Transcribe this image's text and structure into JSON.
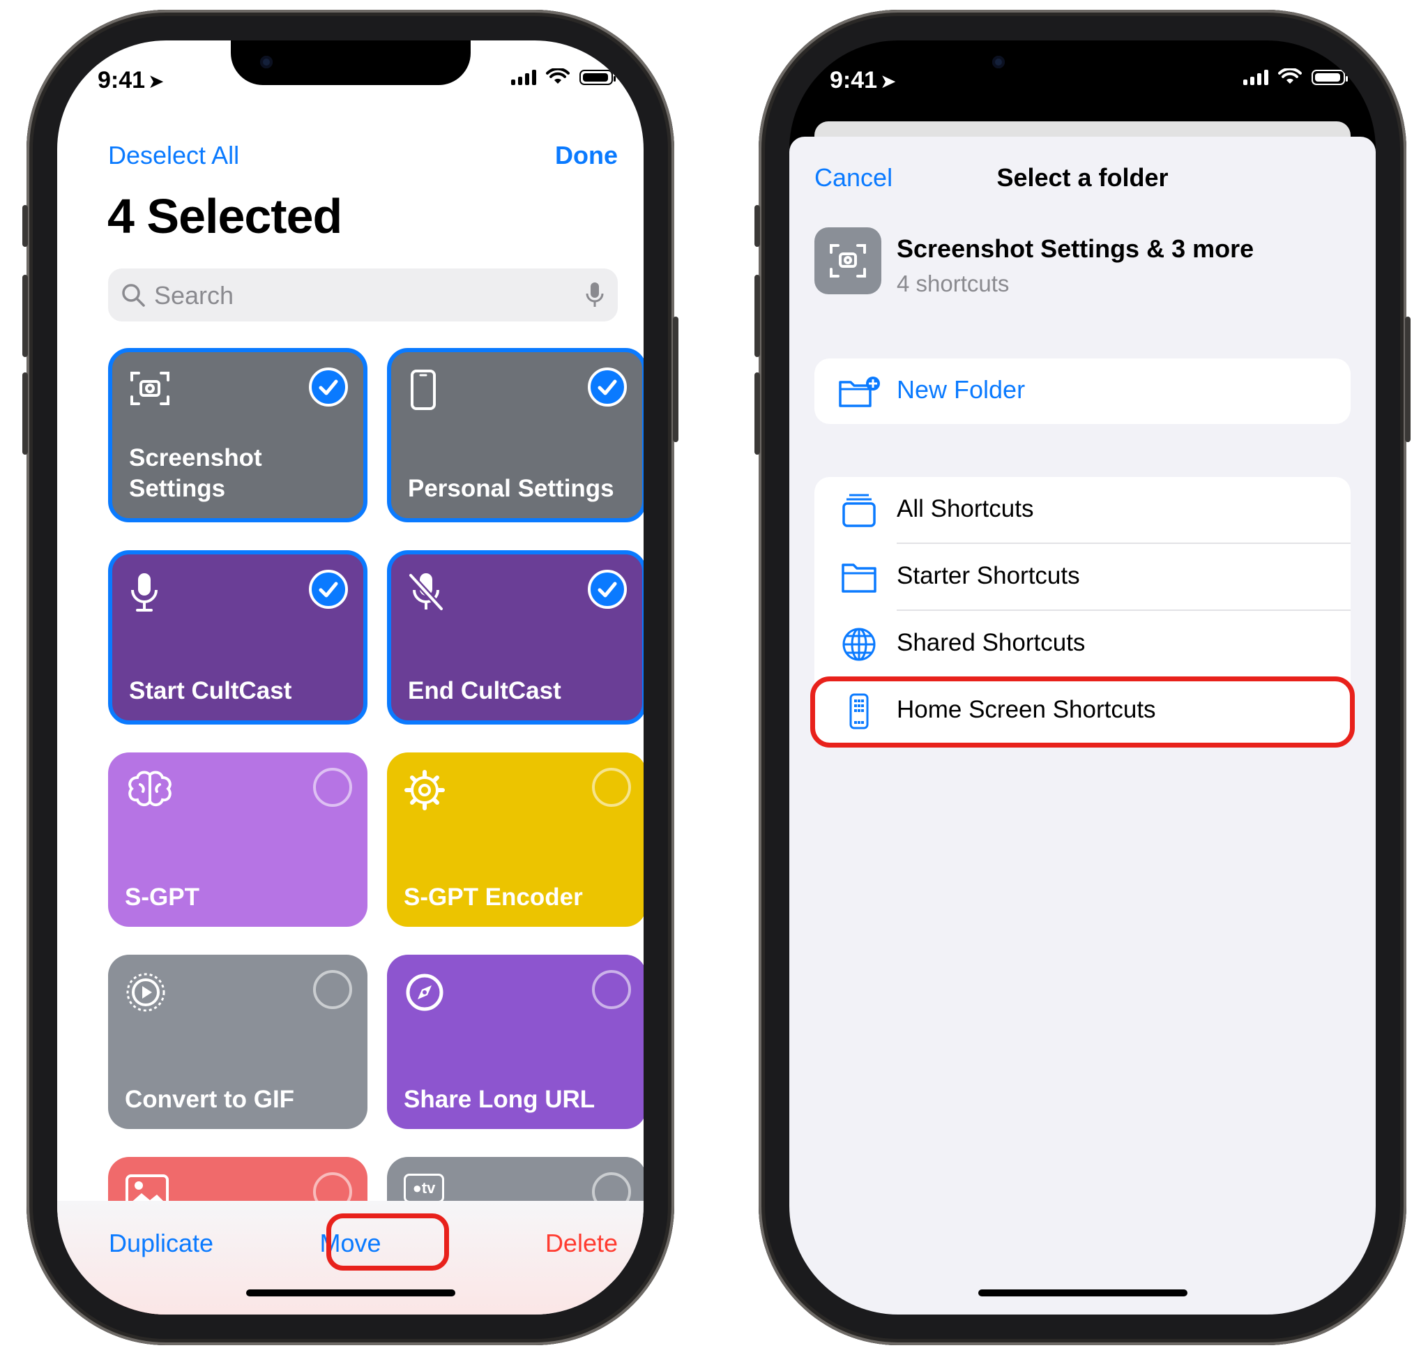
{
  "status_bar": {
    "time": "9:41"
  },
  "left": {
    "nav": {
      "deselect_all": "Deselect All",
      "done": "Done"
    },
    "title": "4 Selected",
    "search": {
      "placeholder": "Search"
    },
    "tiles": [
      {
        "label": "Screenshot\nSettings",
        "icon": "screenshot-icon",
        "color": "#6d7177",
        "selected": true
      },
      {
        "label": "Personal Settings",
        "icon": "iphone-icon",
        "color": "#6d7177",
        "selected": true
      },
      {
        "label": "Start CultCast",
        "icon": "microphone-icon",
        "color": "#6a3e96",
        "selected": true
      },
      {
        "label": "End CultCast",
        "icon": "mic-slash-icon",
        "color": "#6a3e96",
        "selected": true
      },
      {
        "label": "S-GPT",
        "icon": "brain-icon",
        "color": "#b674e4",
        "selected": false
      },
      {
        "label": "S-GPT Encoder",
        "icon": "gear-icon",
        "color": "#ecc400",
        "selected": false
      },
      {
        "label": "Convert to GIF",
        "icon": "play-icon",
        "color": "#8b9098",
        "selected": false
      },
      {
        "label": "Share Long URL",
        "icon": "compass-icon",
        "color": "#8d55cf",
        "selected": false
      },
      {
        "label": "",
        "icon": "photo-icon",
        "color": "#f06a6b",
        "selected": false
      },
      {
        "label": "",
        "icon": "apple-tv-icon",
        "color": "#8b9098",
        "selected": false
      }
    ],
    "apple_tv_glyph": "tv",
    "toolbar": {
      "duplicate": "Duplicate",
      "move": "Move",
      "delete": "Delete"
    }
  },
  "right": {
    "cancel": "Cancel",
    "title": "Select a folder",
    "item": {
      "title": "Screenshot Settings & 3 more",
      "subtitle": "4 shortcuts"
    },
    "new_folder": "New Folder",
    "folders": [
      {
        "label": "All Shortcuts",
        "icon": "stack-icon"
      },
      {
        "label": "Starter Shortcuts",
        "icon": "folder-icon"
      },
      {
        "label": "Shared Shortcuts",
        "icon": "globe-icon"
      },
      {
        "label": "Home Screen Shortcuts",
        "icon": "home-screen-icon"
      }
    ]
  },
  "colors": {
    "accent": "#0a7aff",
    "destructive": "#ff3b30",
    "highlight": "#e8211b"
  }
}
